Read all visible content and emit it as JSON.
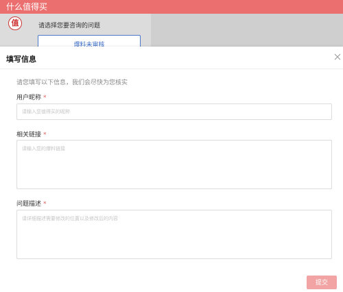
{
  "app": {
    "title": "什么值得买"
  },
  "background": {
    "avatar_glyph": "值",
    "question": "请选择您要咨询的问题",
    "tag_label": "爆料未审核"
  },
  "modal": {
    "title": "填写信息",
    "intro": "请您填写以下信息，我们会尽快为您核实",
    "fields": {
      "nickname": {
        "label": "用户昵称",
        "required_mark": "*",
        "placeholder": "请输入您值得买的昵称",
        "value": ""
      },
      "link": {
        "label": "相关链接",
        "required_mark": "*",
        "placeholder": "请输入您的爆料链接",
        "value": ""
      },
      "description": {
        "label": "问题描述",
        "required_mark": "*",
        "placeholder": "请详细描述需要修改的位置以及修改后的内容",
        "value": ""
      }
    },
    "submit_label": "提交",
    "close_icon": "close-icon"
  },
  "colors": {
    "brand": "#ec6f6f",
    "submit_disabled": "#f2a4a4",
    "required": "#e05c5c",
    "link_blue": "#3d6fc8"
  }
}
